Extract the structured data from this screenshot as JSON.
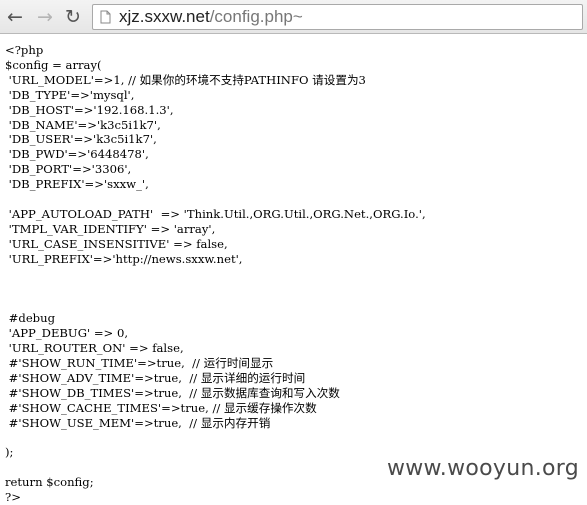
{
  "browser": {
    "address_domain": "xjz.sxxw.net",
    "address_path": "/config.php~",
    "icons": {
      "back": "back-arrow-icon",
      "forward": "forward-arrow-icon",
      "reload": "reload-icon",
      "page": "page-icon"
    }
  },
  "source_lines": [
    "<?php",
    "$config = array(",
    " 'URL_MODEL'=>1, // 如果你的环境不支持PATHINFO 请设置为3",
    " 'DB_TYPE'=>'mysql',",
    " 'DB_HOST'=>'192.168.1.3',",
    " 'DB_NAME'=>'k3c5i1k7',",
    " 'DB_USER'=>'k3c5i1k7',",
    " 'DB_PWD'=>'6448478',",
    " 'DB_PORT'=>'3306',",
    " 'DB_PREFIX'=>'sxxw_',",
    "",
    " 'APP_AUTOLOAD_PATH'  => 'Think.Util.,ORG.Util.,ORG.Net.,ORG.Io.',",
    " 'TMPL_VAR_IDENTIFY' => 'array',",
    " 'URL_CASE_INSENSITIVE' => false,",
    " 'URL_PREFIX'=>'http://news.sxxw.net',",
    "",
    "",
    "",
    " #debug",
    " 'APP_DEBUG' => 0,",
    " 'URL_ROUTER_ON' => false,",
    " #'SHOW_RUN_TIME'=>true,  // 运行时间显示",
    " #'SHOW_ADV_TIME'=>true,  // 显示详细的运行时间",
    " #'SHOW_DB_TIMES'=>true,  // 显示数据库查询和写入次数",
    " #'SHOW_CACHE_TIMES'=>true, // 显示缓存操作次数",
    " #'SHOW_USE_MEM'=>true,  // 显示内存开销",
    "",
    ");",
    "",
    "return $config;",
    "?>"
  ],
  "watermark": "www.wooyun.org"
}
